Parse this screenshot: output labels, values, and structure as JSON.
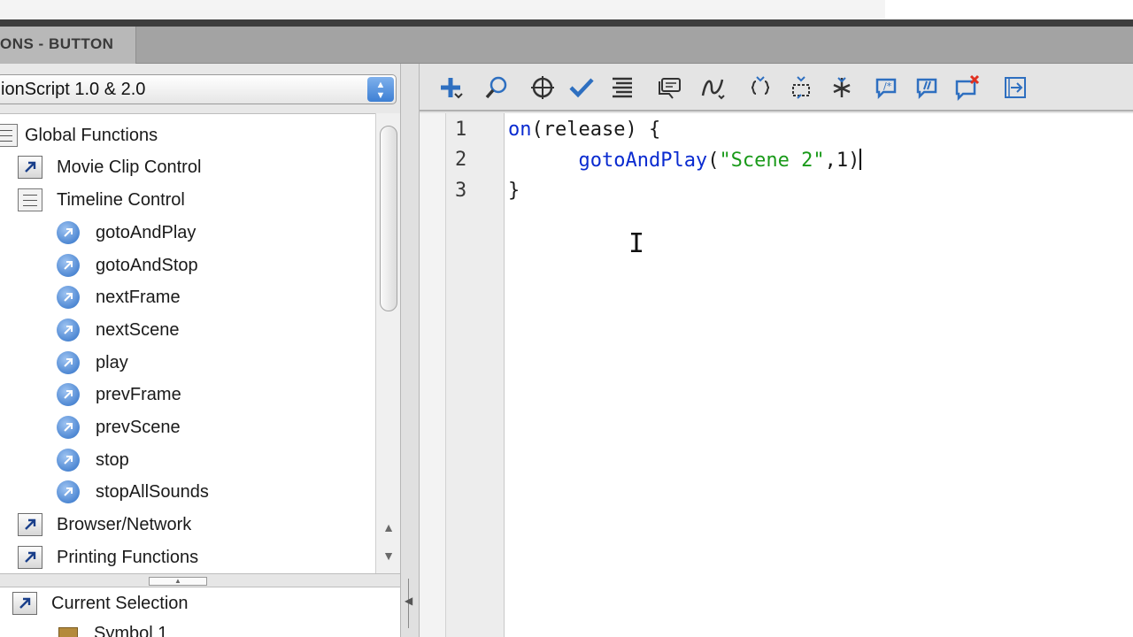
{
  "panel": {
    "title": "ONS - BUTTON"
  },
  "language_select": {
    "value": "ionScript 1.0 & 2.0"
  },
  "tree": [
    {
      "label": "Global Functions",
      "kind": "book"
    },
    {
      "label": "Movie Clip Control",
      "kind": "folder"
    },
    {
      "label": "Timeline Control",
      "kind": "book"
    },
    {
      "label": "gotoAndPlay",
      "kind": "function"
    },
    {
      "label": "gotoAndStop",
      "kind": "function"
    },
    {
      "label": "nextFrame",
      "kind": "function"
    },
    {
      "label": "nextScene",
      "kind": "function"
    },
    {
      "label": "play",
      "kind": "function"
    },
    {
      "label": "prevFrame",
      "kind": "function"
    },
    {
      "label": "prevScene",
      "kind": "function"
    },
    {
      "label": "stop",
      "kind": "function"
    },
    {
      "label": "stopAllSounds",
      "kind": "function"
    },
    {
      "label": "Browser/Network",
      "kind": "folder"
    },
    {
      "label": "Printing Functions",
      "kind": "folder"
    }
  ],
  "bottom_tree": {
    "current_selection": "Current Selection",
    "partial_item": "Symbol 1"
  },
  "toolbar_icons": [
    "add-statement-icon",
    "find-icon",
    "insert-target-path-icon",
    "check-syntax-icon",
    "auto-format-icon",
    "show-code-hint-icon",
    "debug-options-icon",
    "collapse-between-braces-icon",
    "collapse-selection-icon",
    "expand-all-icon",
    "apply-block-comment-icon",
    "apply-line-comment-icon",
    "remove-comment-icon",
    "show-hide-toolbox-icon"
  ],
  "code": {
    "line_numbers": [
      "1",
      "2",
      "3"
    ],
    "line1_keyword": "on",
    "line1_rest": "(release) {",
    "line2_indent": "      ",
    "line2_func": "gotoAndPlay",
    "line2_open": "(",
    "line2_string": "\"Scene 2\"",
    "line2_rest": ",1)",
    "line3": "}"
  },
  "colors": {
    "keyword": "#0a2bd0",
    "string": "#1a9a1a",
    "accent": "#2e6fc0"
  }
}
